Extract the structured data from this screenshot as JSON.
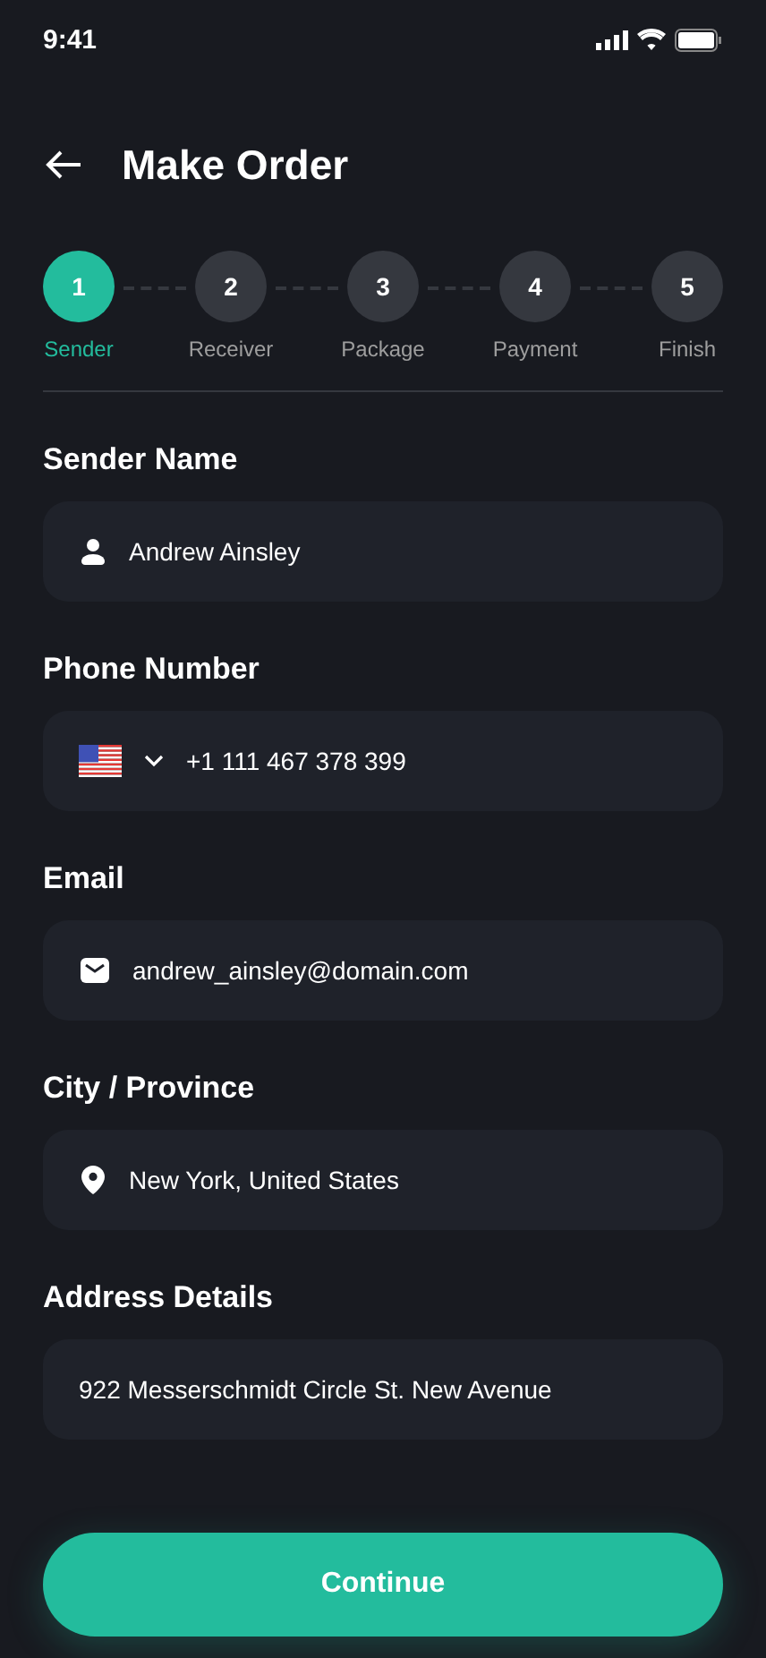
{
  "status_bar": {
    "time": "9:41"
  },
  "header": {
    "title": "Make Order"
  },
  "steps": [
    {
      "number": "1",
      "label": "Sender",
      "selected": true
    },
    {
      "number": "2",
      "label": "Receiver",
      "selected": false
    },
    {
      "number": "3",
      "label": "Package",
      "selected": false
    },
    {
      "number": "4",
      "label": "Payment",
      "selected": false
    },
    {
      "number": "5",
      "label": "Finish",
      "selected": false
    }
  ],
  "fields": [
    {
      "label": "Sender Name",
      "kind": "person",
      "value": "Andrew Ainsley"
    },
    {
      "label": "Phone Number",
      "kind": "phone",
      "value": "+1 111 467 378 399"
    },
    {
      "label": "Email",
      "kind": "email",
      "value": "andrew_ainsley@domain.com"
    },
    {
      "label": "City / Province",
      "kind": "location",
      "value": "New York, United States"
    },
    {
      "label": "Address Details",
      "kind": "plain",
      "value": "922 Messerschmidt Circle St. New Avenue"
    }
  ],
  "button": {
    "label": "Continue"
  }
}
